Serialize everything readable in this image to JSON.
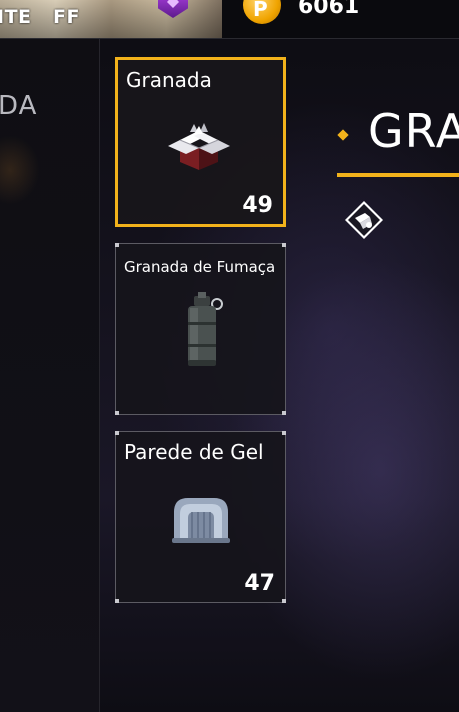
{
  "topbar": {
    "banner_text_left": "ITE",
    "banner_text_right": "FF",
    "coin_symbol": "P",
    "coin_amount": "6061"
  },
  "left_panel": {
    "category_label": "DA"
  },
  "items": [
    {
      "name": "Granada",
      "count": "49",
      "selected": true,
      "icon": "grenade-crate-icon"
    },
    {
      "name": "Granada de Fumaça",
      "count": "",
      "selected": false,
      "icon": "smoke-grenade-icon"
    },
    {
      "name": "Parede de Gel",
      "count": "47",
      "selected": false,
      "icon": "gel-wall-icon"
    }
  ],
  "detail": {
    "title": "GRA",
    "type_icon": "throwable-type-icon"
  },
  "colors": {
    "accent": "#f2b21b",
    "card_border": "#5c5b63",
    "card_bg": "#16151b"
  }
}
